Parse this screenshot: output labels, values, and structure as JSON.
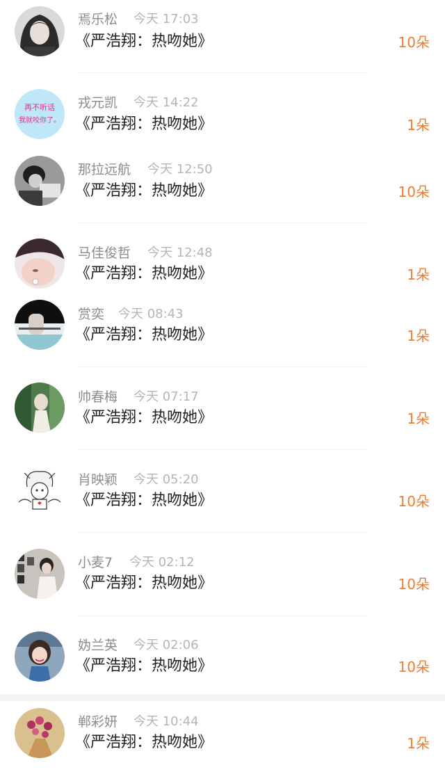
{
  "colors": {
    "username": "#8c8c8c",
    "time": "#b5b5b5",
    "title": "#222222",
    "count": "#f07b2c"
  },
  "rows": [
    {
      "user": "焉乐松",
      "time": "今天 17:03",
      "title": "《严浩翔：热吻她》",
      "count": "10朵",
      "avatar": "girl-portrait-avatar"
    },
    {
      "user": "戎元凯",
      "time": "今天 14:22",
      "title": "《严浩翔：热吻她》",
      "count": "1朵",
      "avatar": "text-sticker-avatar",
      "avatar_text_1": "再不听话",
      "avatar_text_2": "我就咬你了。"
    },
    {
      "user": "那拉远航",
      "time": "今天 12:50",
      "title": "《严浩翔：热吻她》",
      "count": "10朵",
      "avatar": "monochrome-boy-avatar"
    },
    {
      "user": "马佳俊哲",
      "time": "今天 12:48",
      "title": "《严浩翔：热吻她》",
      "count": "1朵",
      "avatar": "baby-avatar"
    },
    {
      "user": "赏奕",
      "time": "今天 08:43",
      "title": "《严浩翔：热吻她》",
      "count": "1朵",
      "avatar": "hand-text-avatar"
    },
    {
      "user": "帅春梅",
      "time": "今天 07:17",
      "title": "《严浩翔：热吻她》",
      "count": "1朵",
      "avatar": "green-portrait-avatar"
    },
    {
      "user": "肖映颖",
      "time": "今天 05:20",
      "title": "《严浩翔：热吻她》",
      "count": "10朵",
      "avatar": "cartoon-character-avatar"
    },
    {
      "user": "小麦7",
      "time": "今天 02:12",
      "title": "《严浩翔：热吻她》",
      "count": "10朵",
      "avatar": "photo-wall-avatar"
    },
    {
      "user": "妫兰英",
      "time": "今天 02:06",
      "title": "《严浩翔：热吻她》",
      "count": "10朵",
      "avatar": "smiling-girl-avatar"
    },
    {
      "user": "郸彩妍",
      "time": "今天 10:44",
      "title": "《严浩翔：热吻她》",
      "count": "1朵",
      "avatar": "flower-bouquet-avatar"
    }
  ]
}
